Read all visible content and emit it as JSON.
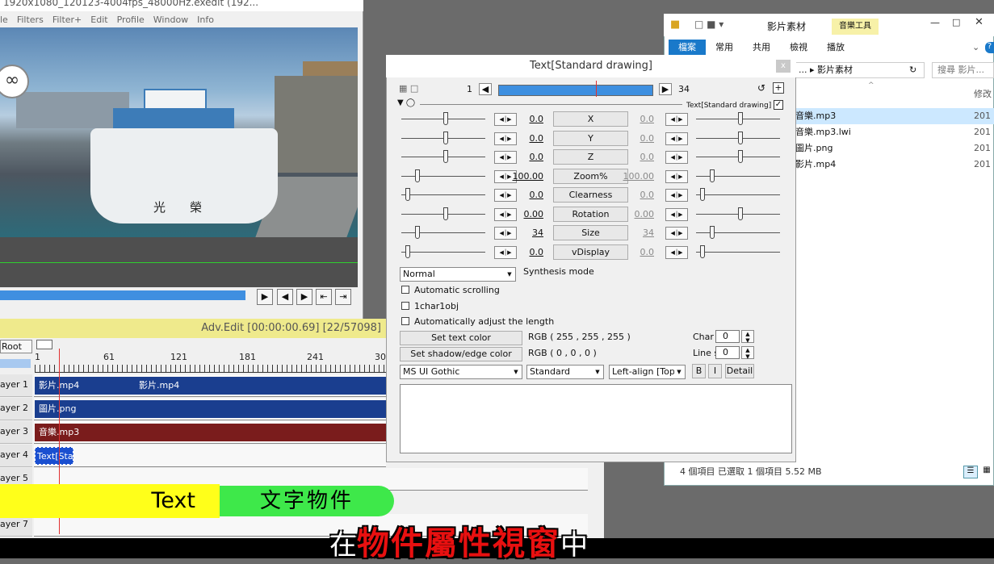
{
  "main_window": {
    "title": "1920x1080_120123-4004fps_48000Hz.exedit (192...",
    "menu": [
      "le",
      "Filters",
      "Filter+",
      "Edit",
      "Profile",
      "Window",
      "Info"
    ],
    "ship_name": "光榮"
  },
  "timeline": {
    "header": "Adv.Edit [00:00:00.69] [22/57098]",
    "root_label": "Root",
    "ruler": [
      "1",
      "61",
      "121",
      "181",
      "241",
      "30"
    ],
    "layers": [
      "ayer 1",
      "ayer 2",
      "ayer 3",
      "ayer 4",
      "ayer 5",
      "",
      "ayer 7"
    ],
    "clips": {
      "l1a": "影片.mp4",
      "l1b": "影片.mp4",
      "l2": "圖片.png",
      "l3": "音樂.mp3",
      "l4": "Text[Sta"
    }
  },
  "explorer": {
    "title": "影片素材",
    "tool_tab": "音樂工具",
    "ribbon": [
      "檔案",
      "常用",
      "共用",
      "檢視",
      "播放"
    ],
    "address": "... ▸ 影片素材",
    "search": "搜尋 影片...",
    "col_modified": "修改",
    "files": [
      {
        "name": "音樂.mp3",
        "date": "201"
      },
      {
        "name": "音樂.mp3.lwi",
        "date": "201"
      },
      {
        "name": "圖片.png",
        "date": "201"
      },
      {
        "name": "影片.mp4",
        "date": "201"
      }
    ],
    "status": "4 個項目    已選取 1 個項目  5.52 MB"
  },
  "dialog": {
    "title": "Text[Standard drawing]",
    "close": "x",
    "frame_start": "1",
    "frame_end": "34",
    "object_label": "Text[Standard drawing]",
    "params": [
      {
        "name": "X",
        "left": "0.0",
        "right": "0.0"
      },
      {
        "name": "Y",
        "left": "0.0",
        "right": "0.0"
      },
      {
        "name": "Z",
        "left": "0.0",
        "right": "0.0"
      },
      {
        "name": "Zoom%",
        "left": "100.00",
        "right": "100.00"
      },
      {
        "name": "Clearness",
        "left": "0.0",
        "right": "0.0"
      },
      {
        "name": "Rotation",
        "left": "0.00",
        "right": "0.00"
      },
      {
        "name": "Size",
        "left": "34",
        "right": "34"
      },
      {
        "name": "vDisplay",
        "left": "0.0",
        "right": "0.0"
      }
    ],
    "synthesis_value": "Normal",
    "synthesis_label": "Synthesis mode",
    "checkboxes": [
      "Automatic scrolling",
      "1char1obj",
      "Automatically adjust the length"
    ],
    "text_color_btn": "Set text color",
    "text_color_val": "RGB ( 255 , 255 , 255 )",
    "shadow_btn": "Set shadow/edge color",
    "shadow_val": "RGB ( 0 , 0 , 0 )",
    "char_label": "Char",
    "char_val": "0",
    "line_label": "Line s",
    "line_val": "0",
    "font": "MS UI Gothic",
    "style": "Standard",
    "align": "Left-align [Top]",
    "bold": "B",
    "italic": "I",
    "detail": "Detail"
  },
  "overlay": {
    "tag_text": "Text",
    "tag_cn": "文字物件",
    "subtitle_pre": "在",
    "subtitle_main": "物件屬性視窗",
    "subtitle_post": "中"
  }
}
